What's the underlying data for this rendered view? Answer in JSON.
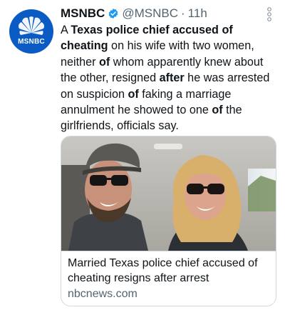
{
  "account": {
    "display_name": "MSNBC",
    "handle": "@MSNBC",
    "separator": "·",
    "time": "11h",
    "avatar_label": "MSNBC",
    "avatar_color": "#0a5bc4"
  },
  "tweet": {
    "text_parts": [
      {
        "text": "A ",
        "bold": false
      },
      {
        "text": "Texas police chief accused of cheating",
        "bold": true
      },
      {
        "text": " on his wife with two women, neither ",
        "bold": false
      },
      {
        "text": "of",
        "bold": true
      },
      {
        "text": " whom apparently knew about the other, resigned ",
        "bold": false
      },
      {
        "text": "after",
        "bold": true
      },
      {
        "text": " he was arrested on suspicion ",
        "bold": false
      },
      {
        "text": "of",
        "bold": true
      },
      {
        "text": " faking a marriage annulment he showed to one ",
        "bold": false
      },
      {
        "text": "of",
        "bold": true
      },
      {
        "text": " the girlfriends, officials say.",
        "bold": false
      }
    ]
  },
  "card": {
    "title": "Married Texas police chief accused of cheating resigns after arrest",
    "domain": "nbcnews.com"
  },
  "icons": {
    "verified": "verified-badge-icon",
    "menu": "more-options-icon",
    "logo": "nbc-peacock-icon"
  },
  "colors": {
    "text": "#0f1419",
    "secondary": "#536471",
    "verified": "#1d9bf0",
    "border": "#cfd9de"
  }
}
